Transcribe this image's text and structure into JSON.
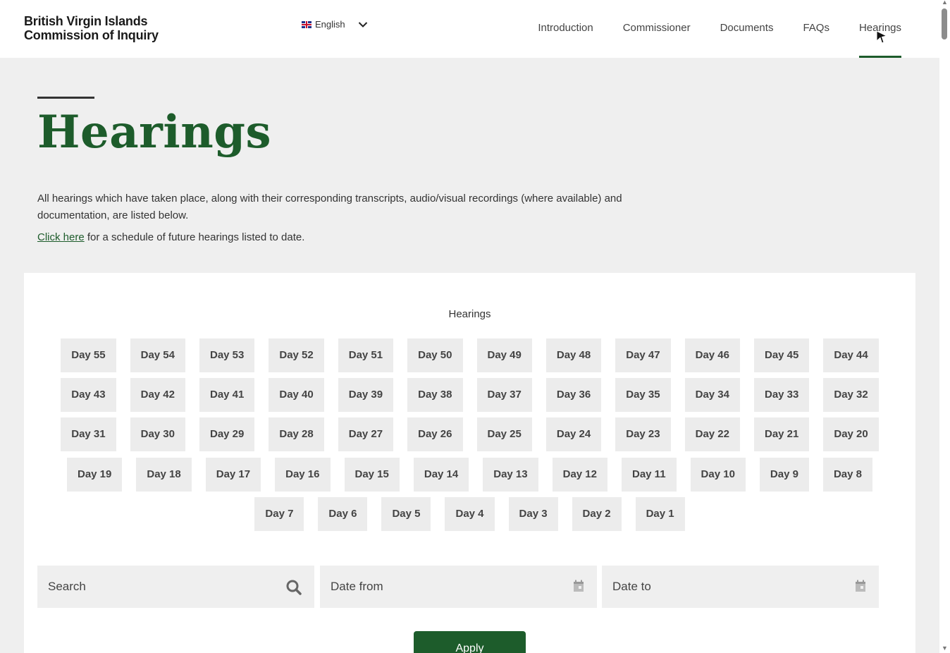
{
  "header": {
    "brand_line1": "British Virgin Islands",
    "brand_line2": "Commission of Inquiry",
    "language": "English",
    "nav": [
      "Introduction",
      "Commissioner",
      "Documents",
      "FAQs",
      "Hearings"
    ],
    "active_nav": "Hearings"
  },
  "hero": {
    "title": "Hearings",
    "intro": "All hearings which have taken place, along with their corresponding transcripts, audio/visual recordings (where available) and documentation, are listed below.",
    "click_here": "Click here",
    "future_text": " for a schedule of future hearings listed to date."
  },
  "card": {
    "title": "Hearings",
    "day_rows": [
      [
        "Day 55",
        "Day 54",
        "Day 53",
        "Day 52",
        "Day 51",
        "Day 50",
        "Day 49",
        "Day 48",
        "Day 47",
        "Day 46",
        "Day 45",
        "Day 44"
      ],
      [
        "Day 43",
        "Day 42",
        "Day 41",
        "Day 40",
        "Day 39",
        "Day 38",
        "Day 37",
        "Day 36",
        "Day 35",
        "Day 34",
        "Day 33",
        "Day 32"
      ],
      [
        "Day 31",
        "Day 30",
        "Day 29",
        "Day 28",
        "Day 27",
        "Day 26",
        "Day 25",
        "Day 24",
        "Day 23",
        "Day 22",
        "Day 21",
        "Day 20"
      ],
      [
        "Day 19",
        "Day 18",
        "Day 17",
        "Day 16",
        "Day 15",
        "Day 14",
        "Day 13",
        "Day 12",
        "Day 11",
        "Day 10",
        "Day 9",
        "Day 8"
      ],
      [
        "Day 7",
        "Day 6",
        "Day 5",
        "Day 4",
        "Day 3",
        "Day 2",
        "Day 1"
      ]
    ],
    "search_placeholder": "Search",
    "date_from_placeholder": "Date from",
    "date_to_placeholder": "Date to",
    "apply_label": "Apply"
  },
  "colors": {
    "brand_green": "#1d5c2b",
    "page_bg": "#efefef",
    "button_bg": "#ececec"
  }
}
